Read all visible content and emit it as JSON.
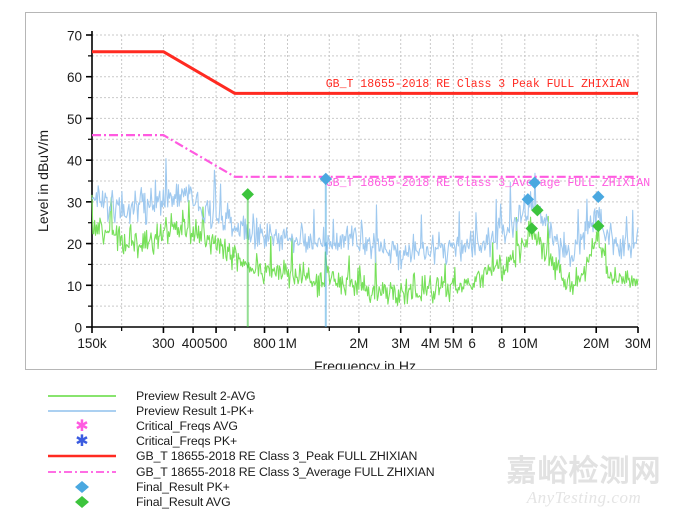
{
  "chart_data": {
    "type": "line",
    "title": "",
    "xlabel": "Frequency in Hz",
    "ylabel": "Level in dBuV/m",
    "xscale": "log",
    "xlim": [
      150000,
      30000000
    ],
    "ylim": [
      0,
      70
    ],
    "ytick_step": 10,
    "yminor_step": 5,
    "grid": true,
    "legend_position": "below",
    "xticks": [
      {
        "value": 150000,
        "label": "150k"
      },
      {
        "value": 200000,
        "label": ""
      },
      {
        "value": 300000,
        "label": "300"
      },
      {
        "value": 400000,
        "label": "400"
      },
      {
        "value": 500000,
        "label": "500"
      },
      {
        "value": 600000,
        "label": ""
      },
      {
        "value": 800000,
        "label": "800"
      },
      {
        "value": 1000000,
        "label": "1M"
      },
      {
        "value": 1500000,
        "label": ""
      },
      {
        "value": 2000000,
        "label": "2M"
      },
      {
        "value": 3000000,
        "label": "3M"
      },
      {
        "value": 4000000,
        "label": "4M"
      },
      {
        "value": 5000000,
        "label": "5M"
      },
      {
        "value": 6000000,
        "label": "6"
      },
      {
        "value": 8000000,
        "label": "8"
      },
      {
        "value": 10000000,
        "label": "10M"
      },
      {
        "value": 20000000,
        "label": "20M"
      },
      {
        "value": 30000000,
        "label": "30M"
      }
    ],
    "yticks": [
      0,
      10,
      20,
      30,
      40,
      50,
      60,
      70
    ],
    "gridlines_x": [
      200000,
      300000,
      400000,
      500000,
      600000,
      800000,
      1000000,
      1500000,
      2000000,
      3000000,
      4000000,
      5000000,
      6000000,
      8000000,
      10000000,
      20000000
    ],
    "series": [
      {
        "name": "Preview Result 2-AVG",
        "type": "spectrum",
        "color": "#77e05a",
        "symbol": "line",
        "seed": 37,
        "noise": 3.2,
        "baseline": [
          {
            "f": 150000,
            "v": 24.5
          },
          {
            "f": 200000,
            "v": 21.0
          },
          {
            "f": 250000,
            "v": 20.0
          },
          {
            "f": 300000,
            "v": 22.5
          },
          {
            "f": 380000,
            "v": 24.5
          },
          {
            "f": 450000,
            "v": 21.0
          },
          {
            "f": 550000,
            "v": 18.0
          },
          {
            "f": 700000,
            "v": 15.0
          },
          {
            "f": 900000,
            "v": 13.0
          },
          {
            "f": 1200000,
            "v": 11.5
          },
          {
            "f": 1500000,
            "v": 11.0
          },
          {
            "f": 1800000,
            "v": 10.5
          },
          {
            "f": 2200000,
            "v": 9.5
          },
          {
            "f": 2800000,
            "v": 8.5
          },
          {
            "f": 3500000,
            "v": 8.8
          },
          {
            "f": 4500000,
            "v": 9.5
          },
          {
            "f": 5500000,
            "v": 10.5
          },
          {
            "f": 7000000,
            "v": 12.5
          },
          {
            "f": 8500000,
            "v": 15.5
          },
          {
            "f": 10000000,
            "v": 20.5
          },
          {
            "f": 11000000,
            "v": 22.5
          },
          {
            "f": 12500000,
            "v": 18.0
          },
          {
            "f": 14000000,
            "v": 12.0
          },
          {
            "f": 16000000,
            "v": 10.0
          },
          {
            "f": 18000000,
            "v": 14.0
          },
          {
            "f": 20000000,
            "v": 21.5
          },
          {
            "f": 21000000,
            "v": 18.0
          },
          {
            "f": 23000000,
            "v": 12.0
          },
          {
            "f": 26000000,
            "v": 11.0
          },
          {
            "f": 30000000,
            "v": 11.5
          }
        ]
      },
      {
        "name": "Preview Result 1-PK+",
        "type": "spectrum",
        "color": "#9fc9ef",
        "symbol": "line",
        "seed": 91,
        "noise": 3.6,
        "baseline": [
          {
            "f": 150000,
            "v": 30.0
          },
          {
            "f": 200000,
            "v": 28.0
          },
          {
            "f": 250000,
            "v": 29.5
          },
          {
            "f": 300000,
            "v": 31.0
          },
          {
            "f": 380000,
            "v": 32.0
          },
          {
            "f": 450000,
            "v": 28.0
          },
          {
            "f": 550000,
            "v": 25.5
          },
          {
            "f": 700000,
            "v": 23.0
          },
          {
            "f": 900000,
            "v": 21.5
          },
          {
            "f": 1200000,
            "v": 20.5
          },
          {
            "f": 1500000,
            "v": 20.0
          },
          {
            "f": 1800000,
            "v": 21.0
          },
          {
            "f": 2200000,
            "v": 20.0
          },
          {
            "f": 2800000,
            "v": 18.5
          },
          {
            "f": 3500000,
            "v": 18.0
          },
          {
            "f": 4500000,
            "v": 18.5
          },
          {
            "f": 5500000,
            "v": 19.0
          },
          {
            "f": 7000000,
            "v": 20.5
          },
          {
            "f": 8500000,
            "v": 23.0
          },
          {
            "f": 10000000,
            "v": 27.5
          },
          {
            "f": 11000000,
            "v": 29.5
          },
          {
            "f": 12500000,
            "v": 25.0
          },
          {
            "f": 14000000,
            "v": 19.5
          },
          {
            "f": 16000000,
            "v": 17.5
          },
          {
            "f": 18000000,
            "v": 21.5
          },
          {
            "f": 20000000,
            "v": 28.0
          },
          {
            "f": 21000000,
            "v": 25.0
          },
          {
            "f": 23000000,
            "v": 20.0
          },
          {
            "f": 26000000,
            "v": 19.5
          },
          {
            "f": 30000000,
            "v": 20.5
          }
        ]
      }
    ],
    "limit_lines": [
      {
        "name": "GB_T 18655-2018 RE Class 3_Peak FULL ZHIXIAN",
        "color": "#ff2a21",
        "style": "solid",
        "annotation": "GB_T 18655-2018 RE Class 3 Peak FULL ZHIXIAN",
        "annotation_f": 1450000,
        "annotation_v": 57.5,
        "points": [
          {
            "f": 150000,
            "v": 66
          },
          {
            "f": 300000,
            "v": 66
          },
          {
            "f": 600000,
            "v": 56
          },
          {
            "f": 30000000,
            "v": 56
          }
        ]
      },
      {
        "name": "GB_T 18655-2018 RE Class 3_Average FULL ZHIXIAN",
        "color": "#ff5ae0",
        "style": "dashdot",
        "annotation": "GB_T 18655-2018 RE Class 3_Average FULL ZHIXIAN",
        "annotation_f": 1450000,
        "annotation_v": 33.8,
        "points": [
          {
            "f": 150000,
            "v": 46
          },
          {
            "f": 300000,
            "v": 46
          },
          {
            "f": 600000,
            "v": 36
          },
          {
            "f": 30000000,
            "v": 36
          }
        ]
      }
    ],
    "markers": [
      {
        "series": "Final_Result AVG",
        "f": 680000,
        "v": 31.8,
        "color": "#3cc43c",
        "stem": true
      },
      {
        "series": "Final_Result PK+",
        "f": 1450000,
        "v": 35.5,
        "color": "#4aa8e0",
        "stem": true
      },
      {
        "series": "Final_Result PK+",
        "f": 10300000,
        "v": 30.6,
        "color": "#4aa8e0",
        "stem": false
      },
      {
        "series": "Final_Result PK+",
        "f": 11000000,
        "v": 34.6,
        "color": "#4aa8e0",
        "stem": false
      },
      {
        "series": "Final_Result AVG",
        "f": 10700000,
        "v": 23.6,
        "color": "#3cc43c",
        "stem": false
      },
      {
        "series": "Final_Result AVG",
        "f": 11300000,
        "v": 28.0,
        "color": "#3cc43c",
        "stem": false
      },
      {
        "series": "Final_Result PK+",
        "f": 20400000,
        "v": 31.2,
        "color": "#4aa8e0",
        "stem": false
      },
      {
        "series": "Final_Result AVG",
        "f": 20400000,
        "v": 24.2,
        "color": "#3cc43c",
        "stem": false
      }
    ]
  },
  "legend": {
    "items": [
      {
        "label": "Preview Result 2-AVG",
        "symbol": "line",
        "color": "#77e05a"
      },
      {
        "label": "Preview Result 1-PK+",
        "symbol": "line",
        "color": "#9fc9ef"
      },
      {
        "label": "Critical_Freqs AVG",
        "symbol": "asterisk",
        "color": "#ff5ae0"
      },
      {
        "label": "Critical_Freqs PK+",
        "symbol": "asterisk",
        "color": "#3b5ce0"
      },
      {
        "label": "GB_T 18655-2018 RE Class 3_Peak FULL ZHIXIAN",
        "symbol": "line",
        "color": "#ff2a21"
      },
      {
        "label": "GB_T 18655-2018 RE Class 3_Average FULL ZHIXIAN",
        "symbol": "dashdot",
        "color": "#ff5ae0"
      },
      {
        "label": "Final_Result PK+",
        "symbol": "diamond",
        "color": "#4aa8e0"
      },
      {
        "label": "Final_Result AVG",
        "symbol": "diamond",
        "color": "#3cc43c"
      }
    ]
  },
  "watermark": {
    "cn": "嘉峪检测网",
    "en": "AnyTesting.com"
  }
}
